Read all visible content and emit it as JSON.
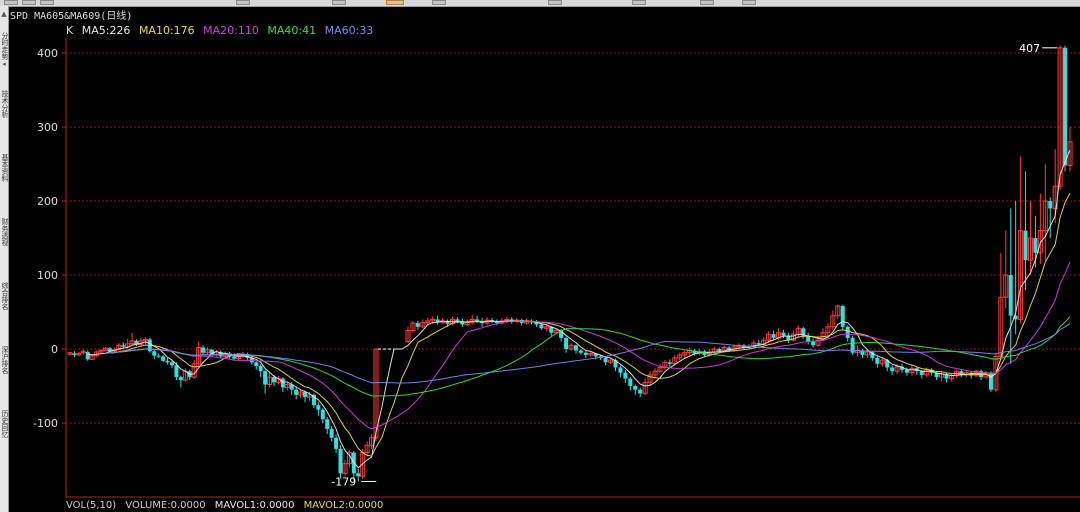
{
  "window": {
    "title": "SPD MA605&MA609(日线)"
  },
  "sidebar": {
    "tabs": [
      "分时走势",
      "技术分析",
      "基本资料",
      "财务透视",
      "综合排名",
      "深沪排名",
      "历史回忆"
    ]
  },
  "indicator": {
    "prefix": "K",
    "ma": [
      {
        "label": "MA5:226",
        "color": "#e8e8e8"
      },
      {
        "label": "MA10:176",
        "color": "#e8d84a"
      },
      {
        "label": "MA20:110",
        "color": "#d53adf"
      },
      {
        "label": "MA40:41",
        "color": "#35e23a"
      },
      {
        "label": "MA60:33",
        "color": "#7b86f0"
      }
    ]
  },
  "volume": {
    "items": [
      {
        "label": "VOL(5,10)",
        "color": "#cccccc"
      },
      {
        "label": "VOLUME:0.0000",
        "color": "#cccccc"
      },
      {
        "label": "MAVOL1:0.0000",
        "color": "#e8e8e8"
      },
      {
        "label": "MAVOL2:0.0000",
        "color": "#e8d84a"
      }
    ]
  },
  "chart_data": {
    "type": "candlestick",
    "y_ticks": [
      400,
      300,
      200,
      100,
      0,
      -100
    ],
    "ylim": [
      -200,
      420
    ],
    "grid": true,
    "max_marker": "407",
    "min_marker": "-179",
    "colors": {
      "up": "#ff3b3b",
      "down": "#30e0e0",
      "grid": "#8a1a1a",
      "axis": "#b02020"
    },
    "candles": [
      [
        -7,
        -5,
        -9,
        -4
      ],
      [
        -6,
        -8,
        -11,
        -3
      ],
      [
        -8,
        -6,
        -10,
        -4
      ],
      [
        -5,
        -3,
        -8,
        -1
      ],
      [
        -4,
        -14,
        -16,
        -2
      ],
      [
        -14,
        -9,
        -15,
        -7
      ],
      [
        -9,
        -4,
        -11,
        -2
      ],
      [
        -4,
        -2,
        -7,
        0
      ],
      [
        -2,
        1,
        -3,
        3
      ],
      [
        1,
        -3,
        -4,
        3
      ],
      [
        -3,
        -1,
        -5,
        2
      ],
      [
        -1,
        5,
        -2,
        8
      ],
      [
        5,
        3,
        1,
        9
      ],
      [
        3,
        7,
        1,
        14
      ],
      [
        7,
        11,
        5,
        22
      ],
      [
        11,
        6,
        4,
        13
      ],
      [
        6,
        11,
        3,
        15
      ],
      [
        11,
        13,
        6,
        16
      ],
      [
        13,
        -3,
        -5,
        15
      ],
      [
        -3,
        -9,
        -14,
        0
      ],
      [
        -9,
        -10,
        -12,
        -6
      ],
      [
        -10,
        -16,
        -18,
        -8
      ],
      [
        -16,
        -18,
        -21,
        -12
      ],
      [
        -18,
        -22,
        -26,
        -14
      ],
      [
        -22,
        -38,
        -42,
        -18
      ],
      [
        -38,
        -42,
        -52,
        -36
      ],
      [
        -42,
        -30,
        -44,
        -26
      ],
      [
        -30,
        -38,
        -42,
        -28
      ],
      [
        -38,
        -20,
        -40,
        -15
      ],
      [
        -20,
        2,
        -22,
        10
      ],
      [
        2,
        -5,
        -8,
        5
      ],
      [
        -5,
        -1,
        -7,
        2
      ],
      [
        -1,
        -8,
        -10,
        0
      ],
      [
        -8,
        -4,
        -10,
        -1
      ],
      [
        -4,
        -10,
        -13,
        -2
      ],
      [
        -10,
        -6,
        -12,
        -3
      ],
      [
        -6,
        -10,
        -14,
        -4
      ],
      [
        -10,
        -13,
        -16,
        -6
      ],
      [
        -13,
        -10,
        -15,
        -7
      ],
      [
        -10,
        -7,
        -12,
        -4
      ],
      [
        -7,
        -12,
        -15,
        -5
      ],
      [
        -12,
        -18,
        -21,
        -10
      ],
      [
        -18,
        -23,
        -28,
        -16
      ],
      [
        -23,
        -30,
        -38,
        -20
      ],
      [
        -30,
        -48,
        -60,
        -28
      ],
      [
        -48,
        -38,
        -52,
        -32
      ],
      [
        -38,
        -45,
        -50,
        -35
      ],
      [
        -45,
        -40,
        -48,
        -36
      ],
      [
        -40,
        -52,
        -58,
        -38
      ],
      [
        -52,
        -48,
        -56,
        -44
      ],
      [
        -48,
        -55,
        -62,
        -45
      ],
      [
        -55,
        -62,
        -68,
        -52
      ],
      [
        -62,
        -58,
        -66,
        -55
      ],
      [
        -58,
        -65,
        -72,
        -56
      ],
      [
        -65,
        -62,
        -70,
        -58
      ],
      [
        -62,
        -76,
        -80,
        -60
      ],
      [
        -76,
        -82,
        -90,
        -72
      ],
      [
        -82,
        -95,
        -100,
        -80
      ],
      [
        -95,
        -108,
        -115,
        -92
      ],
      [
        -108,
        -120,
        -125,
        -104
      ],
      [
        -120,
        -135,
        -140,
        -115
      ],
      [
        -135,
        -168,
        -175,
        -130
      ],
      [
        -168,
        -155,
        -172,
        -150
      ],
      [
        -155,
        -140,
        -160,
        -136
      ],
      [
        -140,
        -168,
        -178,
        -138
      ],
      [
        -168,
        -172,
        -179,
        -162
      ],
      [
        -172,
        -140,
        -176,
        -135
      ],
      [
        -140,
        -130,
        -145,
        -125
      ],
      [
        -130,
        -120,
        -135,
        -115
      ],
      [
        -120,
        0,
        -125,
        0
      ],
      [
        0,
        0,
        0,
        0
      ],
      [
        0,
        0,
        0,
        0
      ],
      [
        0,
        0,
        0,
        0
      ],
      [
        0,
        0,
        0,
        0
      ],
      [
        0,
        0,
        0,
        0
      ],
      [
        0,
        0,
        0,
        0
      ],
      [
        0,
        0,
        0,
        0
      ],
      [
        0,
        0,
        0,
        0
      ],
      [
        0,
        0,
        0,
        0
      ],
      [
        0,
        0,
        0,
        0
      ],
      [
        0,
        0,
        0,
        0
      ],
      [
        0,
        0,
        0,
        0
      ],
      [
        0,
        0,
        0,
        0
      ],
      [
        0,
        0,
        0,
        0
      ],
      [
        0,
        0,
        0,
        0
      ],
      [
        0,
        0,
        0,
        0
      ],
      [
        0,
        0,
        0,
        0
      ],
      [
        0,
        0,
        0,
        0
      ],
      [
        0,
        0,
        0,
        0
      ],
      [
        0,
        0,
        0,
        0
      ],
      [
        0,
        0,
        0,
        0
      ],
      [
        0,
        0,
        0,
        0
      ],
      [
        0,
        0,
        0,
        0
      ],
      [
        0,
        0,
        0,
        0
      ],
      [
        0,
        0,
        0,
        0
      ],
      [
        0,
        0,
        0,
        0
      ],
      [
        0,
        0,
        0,
        0
      ],
      [
        0,
        0,
        0,
        0
      ],
      [
        0,
        0,
        0,
        0
      ],
      [
        0,
        0,
        0,
        0
      ],
      [
        0,
        0,
        0,
        0
      ],
      [
        0,
        0,
        0,
        0
      ],
      [
        0,
        0,
        0,
        0
      ],
      [
        0,
        0,
        0,
        0
      ],
      [
        0,
        0,
        0,
        0
      ],
      [
        0,
        0,
        0,
        0
      ],
      [
        0,
        0,
        0,
        0
      ],
      [
        0,
        0,
        0,
        0
      ],
      [
        0,
        0,
        0,
        0
      ],
      [
        0,
        0,
        0,
        0
      ],
      [
        0,
        0,
        0,
        0
      ],
      [
        0,
        0,
        0,
        0
      ],
      [
        0,
        0,
        0,
        0
      ],
      [
        0,
        0,
        0,
        0
      ],
      [
        0,
        0,
        0,
        0
      ],
      [
        0,
        0,
        0,
        0
      ],
      [
        0,
        0,
        0,
        0
      ]
    ],
    "candles_b": [
      [
        10,
        25,
        8,
        30
      ],
      [
        25,
        35,
        22,
        38
      ],
      [
        35,
        30,
        26,
        38
      ],
      [
        30,
        36,
        28,
        40
      ],
      [
        36,
        38,
        32,
        42
      ],
      [
        38,
        40,
        34,
        44
      ],
      [
        40,
        36,
        33,
        45
      ],
      [
        36,
        38,
        34,
        42
      ],
      [
        38,
        34,
        30,
        40
      ],
      [
        34,
        40,
        32,
        44
      ],
      [
        40,
        38,
        35,
        43
      ],
      [
        38,
        33,
        30,
        41
      ],
      [
        33,
        36,
        31,
        40
      ],
      [
        36,
        40,
        33,
        46
      ],
      [
        40,
        38,
        35,
        45
      ],
      [
        38,
        35,
        30,
        42
      ],
      [
        35,
        39,
        32,
        43
      ],
      [
        39,
        38,
        35,
        42
      ],
      [
        38,
        35,
        32,
        40
      ],
      [
        35,
        38,
        33,
        42
      ],
      [
        38,
        40,
        35,
        44
      ],
      [
        40,
        37,
        34,
        43
      ],
      [
        37,
        39,
        35,
        42
      ],
      [
        39,
        35,
        32,
        41
      ],
      [
        35,
        38,
        33,
        41
      ],
      [
        38,
        36,
        33,
        40
      ],
      [
        36,
        33,
        30,
        39
      ],
      [
        33,
        28,
        26,
        35
      ],
      [
        28,
        30,
        24,
        33
      ],
      [
        30,
        22,
        18,
        31
      ],
      [
        22,
        25,
        20,
        28
      ],
      [
        25,
        15,
        10,
        27
      ],
      [
        15,
        0,
        -5,
        17
      ],
      [
        0,
        5,
        -2,
        8
      ],
      [
        5,
        -2,
        -6,
        6
      ],
      [
        -2,
        -5,
        -8,
        0
      ],
      [
        -5,
        -8,
        -12,
        -3
      ],
      [
        -8,
        -6,
        -10,
        -4
      ],
      [
        -6,
        -10,
        -14,
        -5
      ],
      [
        -10,
        -12,
        -15,
        -8
      ],
      [
        -12,
        -18,
        -22,
        -10
      ],
      [
        -18,
        -15,
        -20,
        -12
      ],
      [
        -15,
        -25,
        -30,
        -13
      ],
      [
        -25,
        -32,
        -38,
        -22
      ],
      [
        -32,
        -40,
        -46,
        -28
      ],
      [
        -40,
        -50,
        -56,
        -38
      ],
      [
        -50,
        -55,
        -62,
        -48
      ],
      [
        -55,
        -60,
        -65,
        -52
      ],
      [
        -60,
        -45,
        -62,
        -40
      ],
      [
        -45,
        -35,
        -48,
        -30
      ],
      [
        -35,
        -30,
        -40,
        -26
      ],
      [
        -30,
        -25,
        -33,
        -20
      ],
      [
        -25,
        -18,
        -28,
        -15
      ],
      [
        -18,
        -20,
        -24,
        -14
      ],
      [
        -20,
        -12,
        -22,
        -8
      ],
      [
        -12,
        -8,
        -15,
        -5
      ],
      [
        -8,
        -5,
        -12,
        -2
      ],
      [
        -5,
        -2,
        -8,
        2
      ],
      [
        -2,
        -6,
        -9,
        0
      ],
      [
        -6,
        -3,
        -8,
        0
      ],
      [
        -3,
        -8,
        -10,
        -1
      ],
      [
        -8,
        -4,
        -10,
        0
      ],
      [
        -4,
        0,
        -6,
        3
      ],
      [
        0,
        -3,
        -5,
        2
      ],
      [
        -3,
        2,
        -5,
        5
      ],
      [
        2,
        -2,
        -4,
        4
      ],
      [
        -2,
        3,
        -4,
        6
      ],
      [
        3,
        5,
        1,
        8
      ],
      [
        5,
        2,
        0,
        7
      ],
      [
        2,
        4,
        0,
        7
      ],
      [
        4,
        8,
        2,
        12
      ],
      [
        8,
        6,
        4,
        12
      ],
      [
        6,
        12,
        4,
        16
      ],
      [
        12,
        20,
        8,
        24
      ],
      [
        20,
        15,
        12,
        25
      ],
      [
        15,
        22,
        12,
        28
      ],
      [
        22,
        18,
        15,
        26
      ],
      [
        18,
        12,
        8,
        22
      ],
      [
        12,
        20,
        10,
        25
      ],
      [
        20,
        28,
        15,
        32
      ],
      [
        28,
        18,
        14,
        30
      ],
      [
        18,
        10,
        6,
        22
      ],
      [
        10,
        5,
        2,
        14
      ],
      [
        5,
        12,
        3,
        18
      ],
      [
        12,
        22,
        10,
        28
      ],
      [
        22,
        30,
        18,
        35
      ],
      [
        30,
        45,
        26,
        52
      ],
      [
        45,
        58,
        40,
        60
      ],
      [
        58,
        30,
        25,
        60
      ],
      [
        30,
        15,
        10,
        32
      ],
      [
        15,
        -5,
        -8,
        18
      ],
      [
        -5,
        -2,
        -10,
        5
      ],
      [
        -2,
        -8,
        -12,
        0
      ],
      [
        -8,
        -4,
        -12,
        -1
      ],
      [
        -4,
        -12,
        -16,
        -3
      ],
      [
        -12,
        -20,
        -25,
        -10
      ],
      [
        -20,
        -15,
        -24,
        -12
      ],
      [
        -15,
        -25,
        -30,
        -13
      ],
      [
        -25,
        -30,
        -35,
        -22
      ],
      [
        -30,
        -24,
        -34,
        -20
      ],
      [
        -24,
        -28,
        -32,
        -20
      ],
      [
        -28,
        -32,
        -36,
        -25
      ],
      [
        -32,
        -26,
        -36,
        -22
      ],
      [
        -26,
        -30,
        -35,
        -24
      ],
      [
        -30,
        -35,
        -40,
        -28
      ],
      [
        -35,
        -28,
        -38,
        -25
      ],
      [
        -28,
        -32,
        -36,
        -26
      ],
      [
        -32,
        -38,
        -42,
        -30
      ],
      [
        -38,
        -34,
        -44,
        -30
      ],
      [
        -34,
        -40,
        -45,
        -32
      ],
      [
        -40,
        -36,
        -44,
        -33
      ],
      [
        -36,
        -30,
        -40,
        -28
      ],
      [
        -30,
        -35,
        -38,
        -28
      ],
      [
        -35,
        -32,
        -38,
        -29
      ],
      [
        -32,
        -36,
        -40,
        -30
      ],
      [
        -36,
        -30,
        -38,
        -28
      ],
      [
        -30,
        -38,
        -42,
        -28
      ],
      [
        -38,
        -32,
        -40,
        -30
      ],
      [
        -32,
        -55,
        -58,
        -30
      ],
      [
        -55,
        -10,
        -58,
        -5
      ],
      [
        -10,
        70,
        -14,
        130
      ],
      [
        70,
        100,
        55,
        160
      ],
      [
        100,
        45,
        -20,
        190
      ],
      [
        45,
        40,
        20,
        200
      ],
      [
        40,
        160,
        35,
        260
      ],
      [
        160,
        120,
        80,
        240
      ],
      [
        120,
        150,
        100,
        200
      ],
      [
        150,
        130,
        110,
        180
      ],
      [
        130,
        160,
        115,
        210
      ],
      [
        160,
        200,
        120,
        250
      ],
      [
        200,
        190,
        150,
        205
      ],
      [
        190,
        220,
        170,
        270
      ],
      [
        220,
        407,
        215,
        410
      ],
      [
        407,
        248,
        240,
        410
      ],
      [
        248,
        280,
        240,
        300
      ]
    ]
  }
}
